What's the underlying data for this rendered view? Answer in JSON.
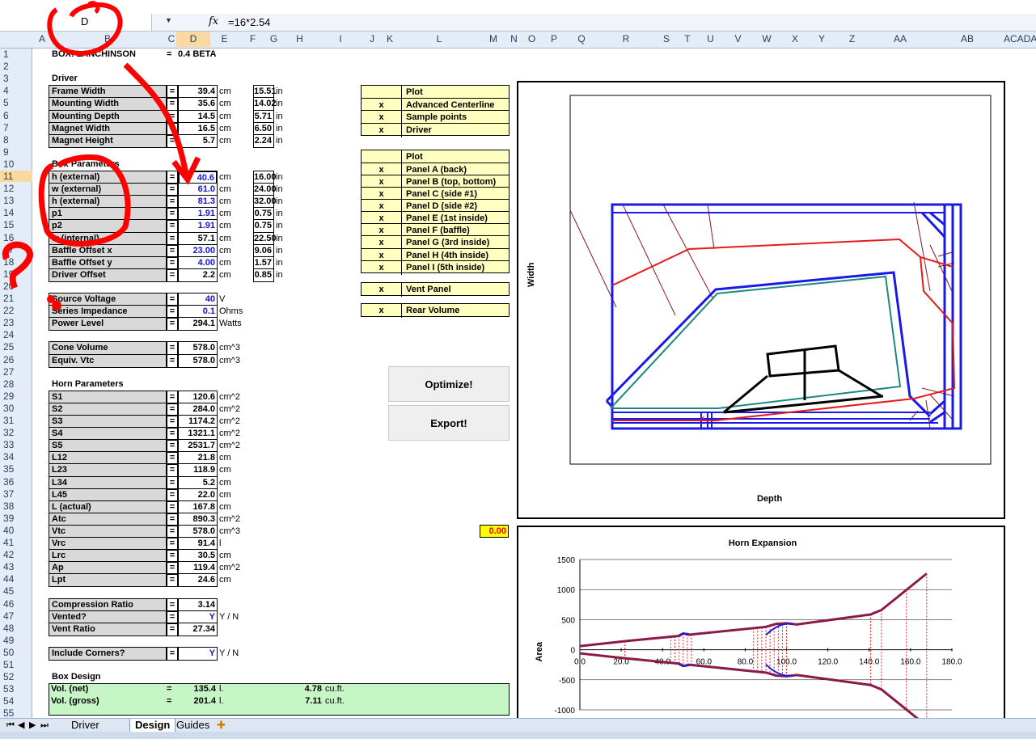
{
  "formula_bar": {
    "name_box": "D",
    "fx": "𝑓x",
    "formula": "=16*2.54"
  },
  "columns": [
    "A",
    "B",
    "C",
    "D",
    "E",
    "F",
    "G",
    "H",
    "I",
    "J",
    "K",
    "L",
    "M",
    "N",
    "O",
    "P",
    "Q",
    "R",
    "S",
    "T",
    "U",
    "V",
    "W",
    "X",
    "Y",
    "Z",
    "AA",
    "AB",
    "ACADAE"
  ],
  "rows": [
    "1",
    "2",
    "3",
    "4",
    "5",
    "6",
    "7",
    "8",
    "9",
    "10",
    "11",
    "12",
    "13",
    "14",
    "15",
    "16",
    "17",
    "18",
    "19",
    "20",
    "21",
    "22",
    "23",
    "24",
    "25",
    "26",
    "27",
    "28",
    "29",
    "30",
    "31",
    "32",
    "33",
    "34",
    "35",
    "36",
    "37",
    "38",
    "39",
    "40",
    "41",
    "42",
    "43",
    "44",
    "45",
    "46",
    "47",
    "48",
    "49",
    "50",
    "51",
    "52",
    "53",
    "54",
    "55"
  ],
  "title": {
    "name": "BOX: LANCHINSON",
    "eq": "=",
    "beta": "0.4 BETA"
  },
  "driver": {
    "heading": "Driver",
    "rows": [
      {
        "label": "Frame Width",
        "eq": "=",
        "val": "39.4",
        "unit": "cm",
        "in": "15.51",
        "in_unit": "in"
      },
      {
        "label": "Mounting Width",
        "eq": "=",
        "val": "35.6",
        "unit": "cm",
        "in": "14.02",
        "in_unit": "in"
      },
      {
        "label": "Mounting Depth",
        "eq": "=",
        "val": "14.5",
        "unit": "cm",
        "in": "5.71",
        "in_unit": "in"
      },
      {
        "label": "Magnet Width",
        "eq": "=",
        "val": "16.5",
        "unit": "cm",
        "in": "6.50",
        "in_unit": "in"
      },
      {
        "label": "Magnet Height",
        "eq": "=",
        "val": "5.7",
        "unit": "cm",
        "in": "2.24",
        "in_unit": "in"
      }
    ]
  },
  "box_params": {
    "heading": "Box Parameters",
    "rows": [
      {
        "label": "h (external)",
        "eq": "=",
        "val": "40.6",
        "unit": "cm",
        "in": "16.00",
        "in_unit": "in",
        "blue": true
      },
      {
        "label": "w (external)",
        "eq": "=",
        "val": "61.0",
        "unit": "cm",
        "in": "24.00",
        "in_unit": "in",
        "blue": true
      },
      {
        "label": "h (external)",
        "eq": "=",
        "val": "81.3",
        "unit": "cm",
        "in": "32.00",
        "in_unit": "in",
        "blue": true
      },
      {
        "label": "p1",
        "eq": "=",
        "val": "1.91",
        "unit": "cm",
        "in": "0.75",
        "in_unit": "in",
        "blue": true
      },
      {
        "label": "p2",
        "eq": "=",
        "val": "1.91",
        "unit": "cm",
        "in": "0.75",
        "in_unit": "in",
        "blue": true
      },
      {
        "label": "w (internal)",
        "eq": "=",
        "val": "57.1",
        "unit": "cm",
        "in": "22.50",
        "in_unit": "in",
        "blue": false
      },
      {
        "label": "Baffle Offset x",
        "eq": "=",
        "val": "23.00",
        "unit": "cm",
        "in": "9.06",
        "in_unit": "in",
        "blue": true
      },
      {
        "label": "Baffle Offset y",
        "eq": "=",
        "val": "4.00",
        "unit": "cm",
        "in": "1.57",
        "in_unit": "in",
        "blue": true
      },
      {
        "label": "Driver Offset",
        "eq": "=",
        "val": "2.2",
        "unit": "cm",
        "in": "0.85",
        "in_unit": "in",
        "blue": false
      }
    ]
  },
  "power": [
    {
      "label": "Source Voltage",
      "eq": "=",
      "val": "40",
      "unit": "V",
      "blue": true
    },
    {
      "label": "Series Impedance",
      "eq": "=",
      "val": "0.1",
      "unit": "Ohms",
      "blue": true
    },
    {
      "label": "Power Level",
      "eq": "=",
      "val": "294.1",
      "unit": "Watts",
      "blue": false
    }
  ],
  "cone": [
    {
      "label": "Cone Volume",
      "eq": "=",
      "val": "578.0",
      "unit": "cm^3"
    },
    {
      "label": "Equiv. Vtc",
      "eq": "=",
      "val": "578.0",
      "unit": "cm^3"
    }
  ],
  "horn_params": {
    "heading": "Horn Parameters",
    "rows": [
      {
        "label": "S1",
        "val": "120.6",
        "unit": "cm^2"
      },
      {
        "label": "S2",
        "val": "284.0",
        "unit": "cm^2"
      },
      {
        "label": "S3",
        "val": "1174.2",
        "unit": "cm^2"
      },
      {
        "label": "S4",
        "val": "1321.1",
        "unit": "cm^2"
      },
      {
        "label": "S5",
        "val": "2531.7",
        "unit": "cm^2"
      },
      {
        "label": "L12",
        "val": "21.8",
        "unit": "cm"
      },
      {
        "label": "L23",
        "val": "118.9",
        "unit": "cm"
      },
      {
        "label": "L34",
        "val": "5.2",
        "unit": "cm"
      },
      {
        "label": "L45",
        "val": "22.0",
        "unit": "cm"
      },
      {
        "label": "L (actual)",
        "val": "167.8",
        "unit": "cm"
      },
      {
        "label": "Atc",
        "val": "890.3",
        "unit": "cm^2"
      },
      {
        "label": "Vtc",
        "val": "578.0",
        "unit": "cm^3"
      },
      {
        "label": "Vrc",
        "val": "91.4",
        "unit": "l"
      },
      {
        "label": "Lrc",
        "val": "30.5",
        "unit": "cm"
      },
      {
        "label": "Ap",
        "val": "119.4",
        "unit": "cm^2"
      },
      {
        "label": "Lpt",
        "val": "24.6",
        "unit": "cm"
      }
    ],
    "eq": "="
  },
  "compression": [
    {
      "label": "Compression Ratio",
      "eq": "=",
      "val": "3.14",
      "unit": "",
      "blue": false
    },
    {
      "label": "Vented?",
      "eq": "=",
      "val": "Y",
      "unit": "Y / N",
      "blue": true
    },
    {
      "label": "Vent Ratio",
      "eq": "=",
      "val": "27.34",
      "unit": "",
      "blue": false
    }
  ],
  "corners": {
    "label": "Include Corners?",
    "eq": "=",
    "val": "Y",
    "unit": "Y / N"
  },
  "box_design": {
    "heading": "Box Design",
    "rows": [
      {
        "label": "Vol. (net)",
        "eq": "=",
        "val": "135.4",
        "unit": "l.",
        "val2": "4.78",
        "unit2": "cu.ft."
      },
      {
        "label": "Vol. (gross)",
        "eq": "=",
        "val": "201.4",
        "unit": "l.",
        "val2": "7.11",
        "unit2": "cu.ft."
      }
    ]
  },
  "plot1": {
    "header": "Plot",
    "items": [
      {
        "x": "x",
        "t": "Advanced Centerline"
      },
      {
        "x": "x",
        "t": "Sample points"
      },
      {
        "x": "x",
        "t": "Driver"
      }
    ]
  },
  "plot2": {
    "header": "Plot",
    "items": [
      {
        "x": "x",
        "t": "Panel A (back)"
      },
      {
        "x": "x",
        "t": "Panel B (top, bottom)"
      },
      {
        "x": "x",
        "t": "Panel C (side #1)"
      },
      {
        "x": "x",
        "t": "Panel D (side #2)"
      },
      {
        "x": "x",
        "t": "Panel E (1st inside)"
      },
      {
        "x": "x",
        "t": "Panel F (baffle)"
      },
      {
        "x": "x",
        "t": "Panel G (3rd inside)"
      },
      {
        "x": "x",
        "t": "Panel H (4th inside)"
      },
      {
        "x": "x",
        "t": "Panel I (5th inside)"
      }
    ]
  },
  "vent": {
    "x": "x",
    "t": "Vent Panel"
  },
  "rear": {
    "x": "x",
    "t": "Rear Volume"
  },
  "buttons": {
    "optimize": "Optimize!",
    "export": "Export!"
  },
  "yellow_value": "0.00",
  "box_chart": {
    "ylabel": "Width",
    "xlabel": "Depth"
  },
  "chart_data": {
    "type": "line",
    "title": "Horn Expansion",
    "xlabel": "",
    "ylabel": "Area",
    "xlim": [
      0,
      180
    ],
    "ylim": [
      -1000,
      1500
    ],
    "x_ticks": [
      "0.0",
      "20.0",
      "40.0",
      "60.0",
      "80.0",
      "100.0",
      "120.0",
      "140.0",
      "160.0",
      "180.0"
    ],
    "y_ticks": [
      "1500",
      "1000",
      "500",
      "0",
      "-500",
      "-1000"
    ],
    "series": [
      {
        "values": [
          [
            0,
            60
          ],
          [
            21.8,
            142
          ],
          [
            48,
            230
          ],
          [
            50,
            270
          ],
          [
            53,
            250
          ],
          [
            90,
            380
          ],
          [
            95,
            430
          ],
          [
            100,
            440
          ],
          [
            105,
            420
          ],
          [
            140.7,
            587
          ],
          [
            145.9,
            660
          ],
          [
            167.8,
            1266
          ]
        ]
      },
      {
        "values": [
          [
            0,
            -60
          ],
          [
            21.8,
            -142
          ],
          [
            48,
            -230
          ],
          [
            50,
            -270
          ],
          [
            53,
            -250
          ],
          [
            90,
            -380
          ],
          [
            95,
            -430
          ],
          [
            100,
            -440
          ],
          [
            105,
            -420
          ],
          [
            140.7,
            -587
          ],
          [
            145.9,
            -660
          ],
          [
            167.8,
            -1266
          ]
        ]
      }
    ],
    "dropline_x": [
      21.8,
      44,
      46,
      48,
      50,
      52,
      54,
      84,
      86,
      88,
      90,
      92,
      94,
      96,
      98,
      100,
      140.7,
      145.9,
      158,
      167.8
    ]
  },
  "tabs": {
    "driver": "Driver",
    "design": "Design",
    "guides": "Guides"
  },
  "colors": {
    "blue": "#1414d6",
    "label_gray": "#d9d9d9",
    "plot_yellow": "#ffffc0",
    "green": "#c6f5c6",
    "chart_maroon": "#8b1a4a",
    "annotation": "#ff0000"
  }
}
